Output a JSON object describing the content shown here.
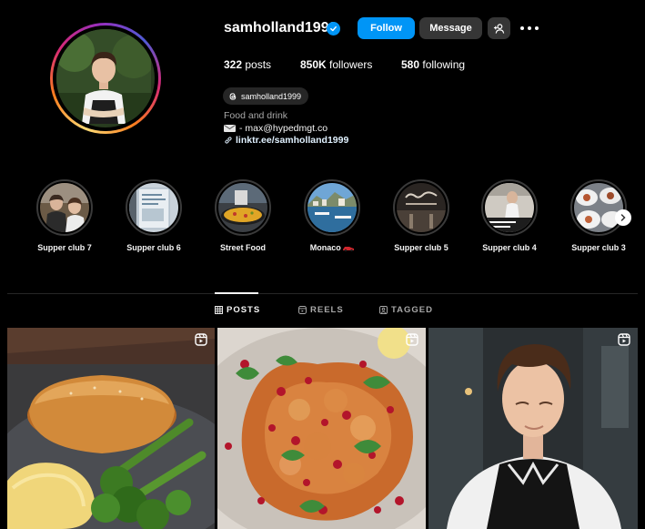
{
  "profile": {
    "username": "samholland1999",
    "verified": true,
    "follow_label": "Follow",
    "message_label": "Message",
    "stats": {
      "posts_count": "322",
      "posts_label": "posts",
      "followers_count": "850K",
      "followers_label": "followers",
      "following_count": "580",
      "following_label": "following"
    },
    "threads_handle": "samholland1999",
    "category": "Food and drink",
    "email_line": "- max@hypedmgt.co",
    "link": "linktr.ee/samholland1999"
  },
  "highlights": [
    {
      "label": "Supper club 7"
    },
    {
      "label": "Supper club 6"
    },
    {
      "label": "Street Food"
    },
    {
      "label": "Monaco"
    },
    {
      "label": "Supper club 5"
    },
    {
      "label": "Supper club 4"
    },
    {
      "label": "Supper club 3"
    }
  ],
  "tabs": {
    "posts": "POSTS",
    "reels": "REELS",
    "tagged": "TAGGED"
  },
  "colors": {
    "accent": "#0095f6",
    "background": "#000000",
    "secondary_button": "#363636"
  }
}
